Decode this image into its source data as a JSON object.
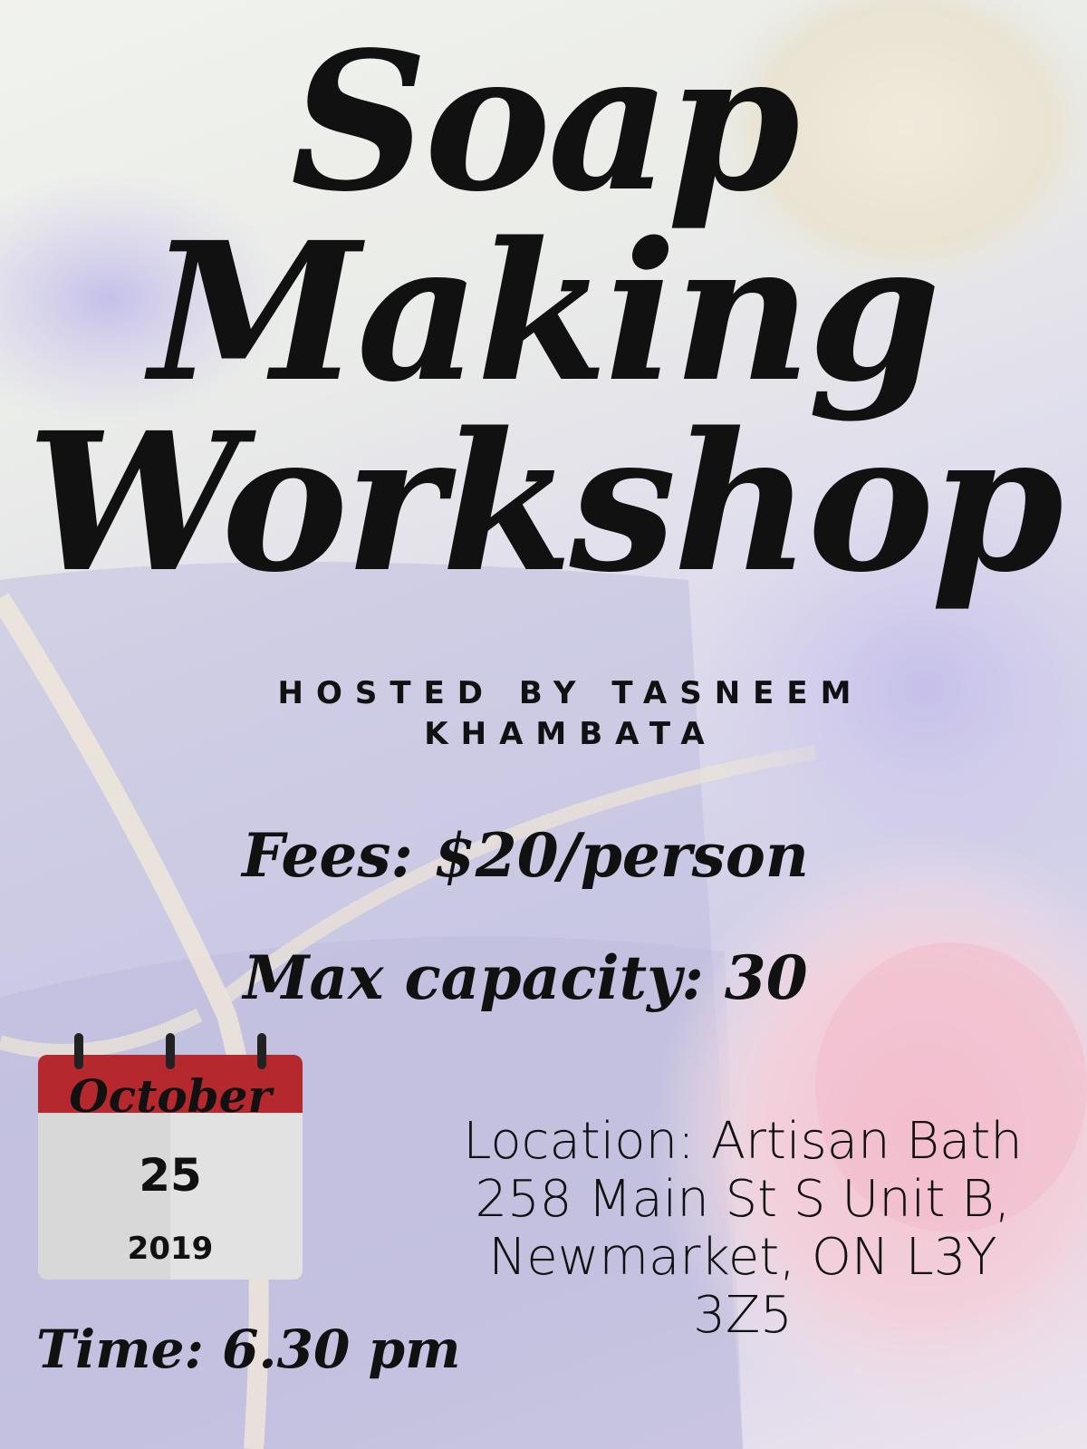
{
  "title": {
    "line1": "Soap",
    "line2": "Making",
    "line3": "Workshop"
  },
  "host": {
    "line1": "HOSTED BY TASNEEM",
    "line2": "KHAMBATA"
  },
  "fees": "Fees: $20/person",
  "capacity": "Max capacity: 30",
  "calendar": {
    "month": "October",
    "day": "25",
    "year": "2019",
    "header_color": "#b4282e"
  },
  "time": "Time: 6.30 pm",
  "location": {
    "line1": "Location: Artisan Bath",
    "line2": "258 Main St S Unit B,",
    "line3": "Newmarket, ON L3Y",
    "line4": "3Z5"
  },
  "icons": [
    "calendar-icon"
  ]
}
